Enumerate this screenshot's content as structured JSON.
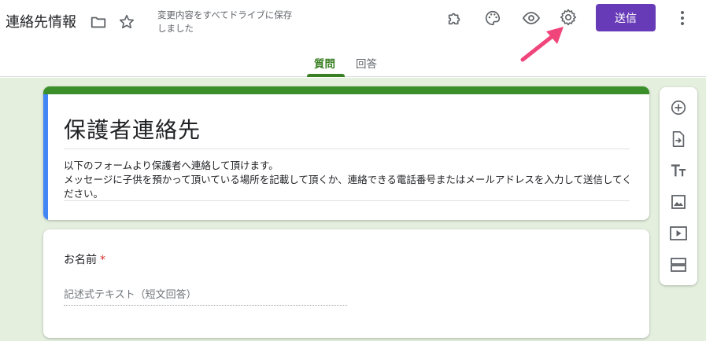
{
  "header": {
    "doc_title": "連絡先情報",
    "save_status": "変更内容をすべてドライブに保存しました",
    "send_label": "送信",
    "icons": [
      "folder-icon",
      "star-icon",
      "addon-icon",
      "palette-icon",
      "eye-icon",
      "gear-icon",
      "more-vert-icon"
    ]
  },
  "tabs": {
    "questions": "質問",
    "responses": "回答",
    "active": "questions"
  },
  "form": {
    "title": "保護者連絡先",
    "description": "以下のフォームより保護者へ連絡して頂けます。\nメッセージに子供を預かって頂いている場所を記載して頂くか、連絡できる電話番号またはメールアドレスを入力して送信してください。"
  },
  "question": {
    "label": "お名前",
    "required_mark": "*",
    "answer_hint": "記述式テキスト（短文回答）"
  },
  "side_toolbar": {
    "tools": [
      "add-question-icon",
      "import-questions-icon",
      "add-title-icon",
      "add-image-icon",
      "add-video-icon",
      "add-section-icon"
    ]
  },
  "colors": {
    "accent": "#3b7f25",
    "send_button": "#673ab7",
    "background": "#e4efde",
    "title_stripe": "#4285f4",
    "annotation_arrow": "#f0457a"
  }
}
